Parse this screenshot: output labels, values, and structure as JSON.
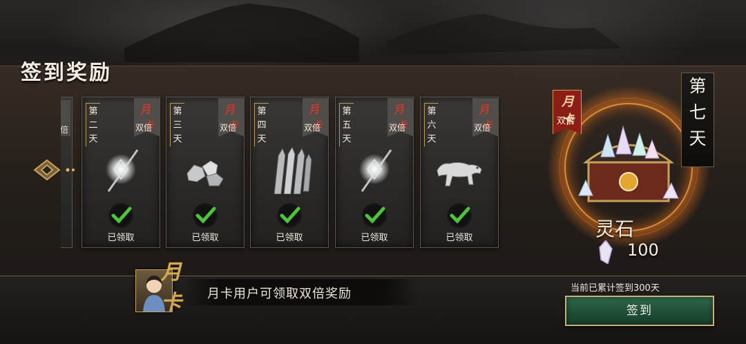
{
  "title": "签到奖励",
  "day_prefix": "第",
  "day_suffix": "天",
  "double_badge": "双倍",
  "month_card_mark": "月卡",
  "partial_card_badge": "倍",
  "days": [
    {
      "num": "二",
      "status": "已领取",
      "item": "orb-sword-icon"
    },
    {
      "num": "三",
      "status": "已领取",
      "item": "silver-ore-icon"
    },
    {
      "num": "四",
      "status": "已领取",
      "item": "flying-daggers-icon"
    },
    {
      "num": "五",
      "status": "已领取",
      "item": "orb-sword-icon"
    },
    {
      "num": "六",
      "status": "已领取",
      "item": "white-leopard-icon"
    }
  ],
  "day7": {
    "label_chars": [
      "第",
      "七",
      "天"
    ],
    "reward_name": "灵石",
    "reward_count": "100"
  },
  "footer": {
    "month_card_hint": "月卡用户可领取双倍奖励",
    "total_signin": "当前已累计签到300天",
    "signin_button": "签到"
  },
  "colors": {
    "accent_gold": "#c9b278",
    "badge_red": "#8c1e18",
    "check_green": "#4cc53a",
    "button_green": "#2f6a4c"
  }
}
